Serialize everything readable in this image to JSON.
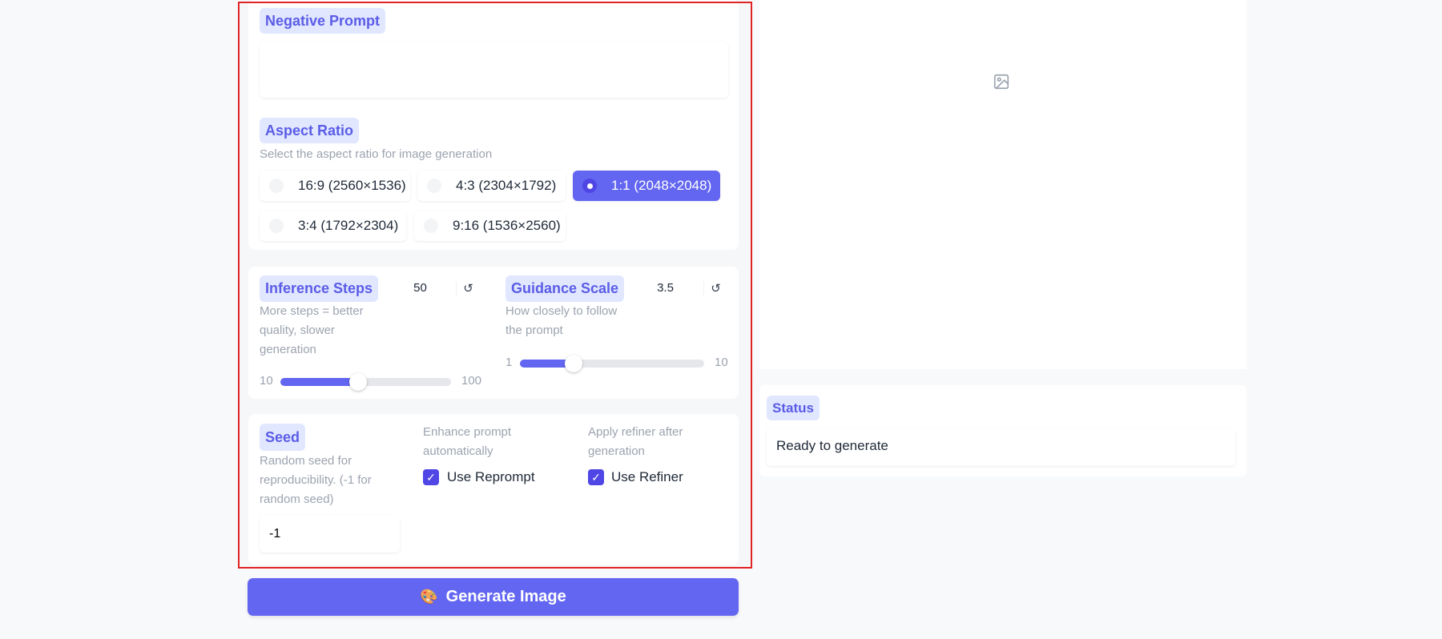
{
  "negative_prompt": {
    "label": "Negative Prompt",
    "value": ""
  },
  "aspect_ratio": {
    "label": "Aspect Ratio",
    "description": "Select the aspect ratio for image generation",
    "options": [
      "16:9 (2560×1536)",
      "4:3 (2304×1792)",
      "1:1 (2048×2048)",
      "3:4 (1792×2304)",
      "9:16 (1536×2560)"
    ],
    "selected": "1:1 (2048×2048)"
  },
  "inference_steps": {
    "label": "Inference Steps",
    "value": "50",
    "description": "More steps = better quality, slower generation",
    "min": "10",
    "max": "100",
    "reset": "↺"
  },
  "guidance_scale": {
    "label": "Guidance Scale",
    "value": "3.5",
    "description": "How closely to follow the prompt",
    "min": "1",
    "max": "10",
    "reset": "↺"
  },
  "seed": {
    "label": "Seed",
    "description": "Random seed for reproducibility. (-1 for random seed)",
    "value": "-1"
  },
  "reprompt": {
    "description": "Enhance prompt automatically",
    "label": "Use Reprompt",
    "checked": true
  },
  "refiner": {
    "description": "Apply refiner after generation",
    "label": "Use Refiner",
    "checked": true
  },
  "generate": {
    "icon": "🎨",
    "label": "Generate Image"
  },
  "status": {
    "label": "Status",
    "value": "Ready to generate"
  },
  "colors": {
    "accent": "#6366f1",
    "label_bg": "#e0e7ff"
  }
}
